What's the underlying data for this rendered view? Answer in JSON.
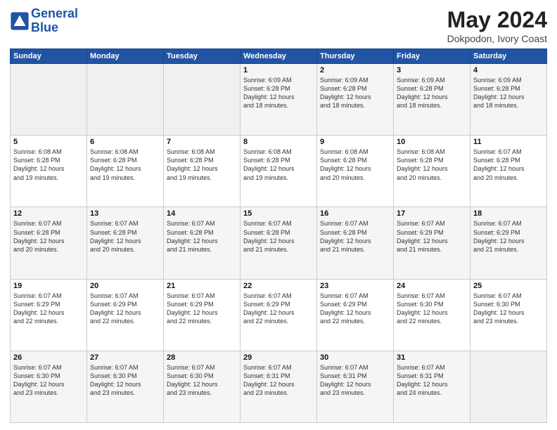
{
  "header": {
    "logo_line1": "General",
    "logo_line2": "Blue",
    "month_year": "May 2024",
    "location": "Dokpodon, Ivory Coast"
  },
  "weekdays": [
    "Sunday",
    "Monday",
    "Tuesday",
    "Wednesday",
    "Thursday",
    "Friday",
    "Saturday"
  ],
  "weeks": [
    [
      {
        "day": "",
        "info": ""
      },
      {
        "day": "",
        "info": ""
      },
      {
        "day": "",
        "info": ""
      },
      {
        "day": "1",
        "info": "Sunrise: 6:09 AM\nSunset: 6:28 PM\nDaylight: 12 hours\nand 18 minutes."
      },
      {
        "day": "2",
        "info": "Sunrise: 6:09 AM\nSunset: 6:28 PM\nDaylight: 12 hours\nand 18 minutes."
      },
      {
        "day": "3",
        "info": "Sunrise: 6:09 AM\nSunset: 6:28 PM\nDaylight: 12 hours\nand 18 minutes."
      },
      {
        "day": "4",
        "info": "Sunrise: 6:09 AM\nSunset: 6:28 PM\nDaylight: 12 hours\nand 18 minutes."
      }
    ],
    [
      {
        "day": "5",
        "info": "Sunrise: 6:08 AM\nSunset: 6:28 PM\nDaylight: 12 hours\nand 19 minutes."
      },
      {
        "day": "6",
        "info": "Sunrise: 6:08 AM\nSunset: 6:28 PM\nDaylight: 12 hours\nand 19 minutes."
      },
      {
        "day": "7",
        "info": "Sunrise: 6:08 AM\nSunset: 6:28 PM\nDaylight: 12 hours\nand 19 minutes."
      },
      {
        "day": "8",
        "info": "Sunrise: 6:08 AM\nSunset: 6:28 PM\nDaylight: 12 hours\nand 19 minutes."
      },
      {
        "day": "9",
        "info": "Sunrise: 6:08 AM\nSunset: 6:28 PM\nDaylight: 12 hours\nand 20 minutes."
      },
      {
        "day": "10",
        "info": "Sunrise: 6:08 AM\nSunset: 6:28 PM\nDaylight: 12 hours\nand 20 minutes."
      },
      {
        "day": "11",
        "info": "Sunrise: 6:07 AM\nSunset: 6:28 PM\nDaylight: 12 hours\nand 20 minutes."
      }
    ],
    [
      {
        "day": "12",
        "info": "Sunrise: 6:07 AM\nSunset: 6:28 PM\nDaylight: 12 hours\nand 20 minutes."
      },
      {
        "day": "13",
        "info": "Sunrise: 6:07 AM\nSunset: 6:28 PM\nDaylight: 12 hours\nand 20 minutes."
      },
      {
        "day": "14",
        "info": "Sunrise: 6:07 AM\nSunset: 6:28 PM\nDaylight: 12 hours\nand 21 minutes."
      },
      {
        "day": "15",
        "info": "Sunrise: 6:07 AM\nSunset: 6:28 PM\nDaylight: 12 hours\nand 21 minutes."
      },
      {
        "day": "16",
        "info": "Sunrise: 6:07 AM\nSunset: 6:28 PM\nDaylight: 12 hours\nand 21 minutes."
      },
      {
        "day": "17",
        "info": "Sunrise: 6:07 AM\nSunset: 6:29 PM\nDaylight: 12 hours\nand 21 minutes."
      },
      {
        "day": "18",
        "info": "Sunrise: 6:07 AM\nSunset: 6:29 PM\nDaylight: 12 hours\nand 21 minutes."
      }
    ],
    [
      {
        "day": "19",
        "info": "Sunrise: 6:07 AM\nSunset: 6:29 PM\nDaylight: 12 hours\nand 22 minutes."
      },
      {
        "day": "20",
        "info": "Sunrise: 6:07 AM\nSunset: 6:29 PM\nDaylight: 12 hours\nand 22 minutes."
      },
      {
        "day": "21",
        "info": "Sunrise: 6:07 AM\nSunset: 6:29 PM\nDaylight: 12 hours\nand 22 minutes."
      },
      {
        "day": "22",
        "info": "Sunrise: 6:07 AM\nSunset: 6:29 PM\nDaylight: 12 hours\nand 22 minutes."
      },
      {
        "day": "23",
        "info": "Sunrise: 6:07 AM\nSunset: 6:29 PM\nDaylight: 12 hours\nand 22 minutes."
      },
      {
        "day": "24",
        "info": "Sunrise: 6:07 AM\nSunset: 6:30 PM\nDaylight: 12 hours\nand 22 minutes."
      },
      {
        "day": "25",
        "info": "Sunrise: 6:07 AM\nSunset: 6:30 PM\nDaylight: 12 hours\nand 23 minutes."
      }
    ],
    [
      {
        "day": "26",
        "info": "Sunrise: 6:07 AM\nSunset: 6:30 PM\nDaylight: 12 hours\nand 23 minutes."
      },
      {
        "day": "27",
        "info": "Sunrise: 6:07 AM\nSunset: 6:30 PM\nDaylight: 12 hours\nand 23 minutes."
      },
      {
        "day": "28",
        "info": "Sunrise: 6:07 AM\nSunset: 6:30 PM\nDaylight: 12 hours\nand 23 minutes."
      },
      {
        "day": "29",
        "info": "Sunrise: 6:07 AM\nSunset: 6:31 PM\nDaylight: 12 hours\nand 23 minutes."
      },
      {
        "day": "30",
        "info": "Sunrise: 6:07 AM\nSunset: 6:31 PM\nDaylight: 12 hours\nand 23 minutes."
      },
      {
        "day": "31",
        "info": "Sunrise: 6:07 AM\nSunset: 6:31 PM\nDaylight: 12 hours\nand 24 minutes."
      },
      {
        "day": "",
        "info": ""
      }
    ]
  ]
}
